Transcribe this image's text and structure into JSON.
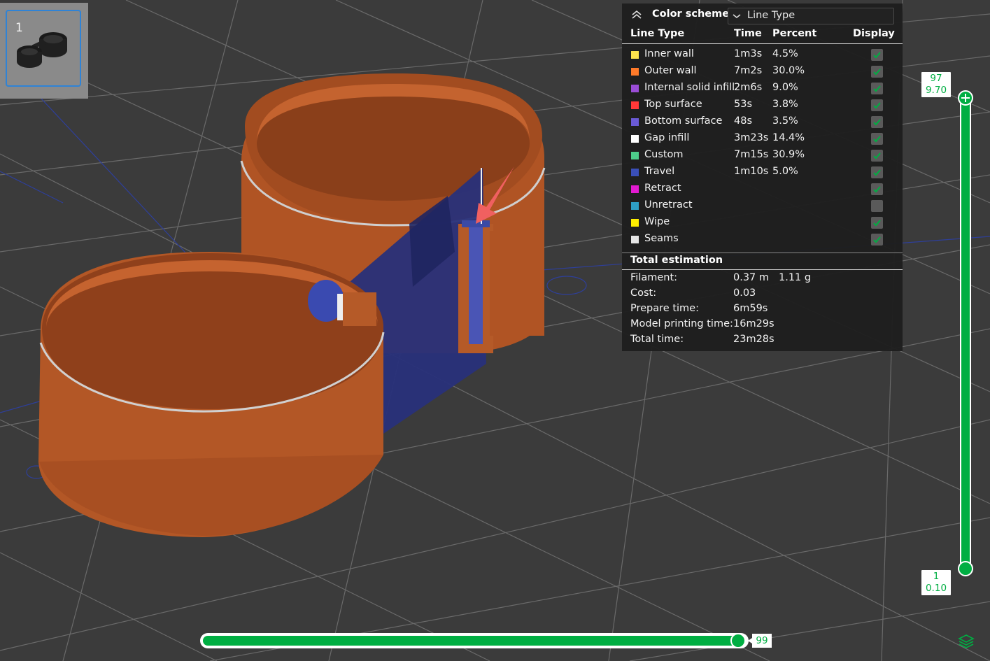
{
  "plate": {
    "number": "1"
  },
  "legend": {
    "title": "Color scheme",
    "scheme_value": "Line Type",
    "headers": {
      "type": "Line Type",
      "time": "Time",
      "percent": "Percent",
      "display": "Display"
    },
    "rows": [
      {
        "name": "Inner wall",
        "time": "1m3s",
        "percent": "4.5%",
        "color": "#ffe34d",
        "checked": true
      },
      {
        "name": "Outer wall",
        "time": "7m2s",
        "percent": "30.0%",
        "color": "#ff7a29",
        "checked": true
      },
      {
        "name": "Internal solid infill",
        "time": "2m6s",
        "percent": "9.0%",
        "color": "#9a4dd6",
        "checked": true
      },
      {
        "name": "Top surface",
        "time": "53s",
        "percent": "3.8%",
        "color": "#ff3838",
        "checked": true
      },
      {
        "name": "Bottom surface",
        "time": "48s",
        "percent": "3.5%",
        "color": "#6a5ad6",
        "checked": true
      },
      {
        "name": "Gap infill",
        "time": "3m23s",
        "percent": "14.4%",
        "color": "#ffffff",
        "checked": true
      },
      {
        "name": "Custom",
        "time": "7m15s",
        "percent": "30.9%",
        "color": "#4dcc8a",
        "checked": true
      },
      {
        "name": "Travel",
        "time": "1m10s",
        "percent": "5.0%",
        "color": "#3a4fb8",
        "checked": true
      },
      {
        "name": "Retract",
        "time": "",
        "percent": "",
        "color": "#e21ad0",
        "checked": true
      },
      {
        "name": "Unretract",
        "time": "",
        "percent": "",
        "color": "#2e9ec4",
        "checked": false
      },
      {
        "name": "Wipe",
        "time": "",
        "percent": "",
        "color": "#ffee00",
        "checked": true
      },
      {
        "name": "Seams",
        "time": "",
        "percent": "",
        "color": "#e6e6e6",
        "checked": true
      }
    ],
    "estimation": {
      "title": "Total estimation",
      "filament_label": "Filament:",
      "filament_length": "0.37 m",
      "filament_weight": "1.11 g",
      "cost_label": "Cost:",
      "cost": "0.03",
      "prepare_label": "Prepare time:",
      "prepare": "6m59s",
      "model_label": "Model printing time:",
      "model": "16m29s",
      "total_label": "Total time:",
      "total": "23m28s"
    }
  },
  "layer_slider": {
    "top_layer": "97",
    "top_height": "9.70",
    "bottom_layer": "1",
    "bottom_height": "0.10"
  },
  "move_slider": {
    "value": "99"
  },
  "colors": {
    "accent": "#00ae42",
    "model": "#b95a2a",
    "travel": "#2a3a8a",
    "panel": "#1e1e1e"
  }
}
